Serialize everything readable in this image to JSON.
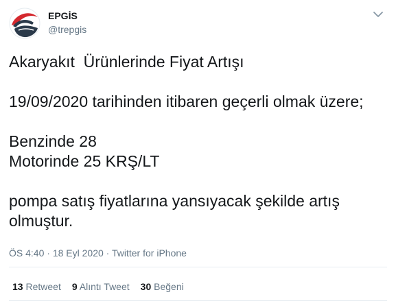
{
  "author": {
    "display_name": "EPGİS",
    "handle": "@trepgis"
  },
  "tweet": {
    "paragraphs": [
      [
        "Akaryakıt  Ürünlerinde Fiyat Artışı"
      ],
      [
        "19/09/2020 tarihinden itibaren geçerli olmak üzere;"
      ],
      [
        "Benzinde 28",
        "Motorinde 25 KRŞ/LT"
      ],
      [
        "pompa satış fiyatlarına yansıyacak şekilde artış",
        "olmuştur."
      ]
    ]
  },
  "meta": {
    "time": "ÖS 4:40",
    "date": "18 Eyl 2020",
    "separator": " · ",
    "source": "Twitter for iPhone"
  },
  "stats": {
    "retweets": {
      "count": "13",
      "label": "Retweet"
    },
    "quotes": {
      "count": "9",
      "label": "Alıntı Tweet"
    },
    "likes": {
      "count": "30",
      "label": "Beğeni"
    }
  },
  "colors": {
    "logo_red": "#d4282e",
    "logo_dark": "#2b3a4a",
    "secondary_text": "#657786"
  },
  "icons": {
    "more": "chevron-down-icon",
    "avatar": "epgis-logo"
  }
}
